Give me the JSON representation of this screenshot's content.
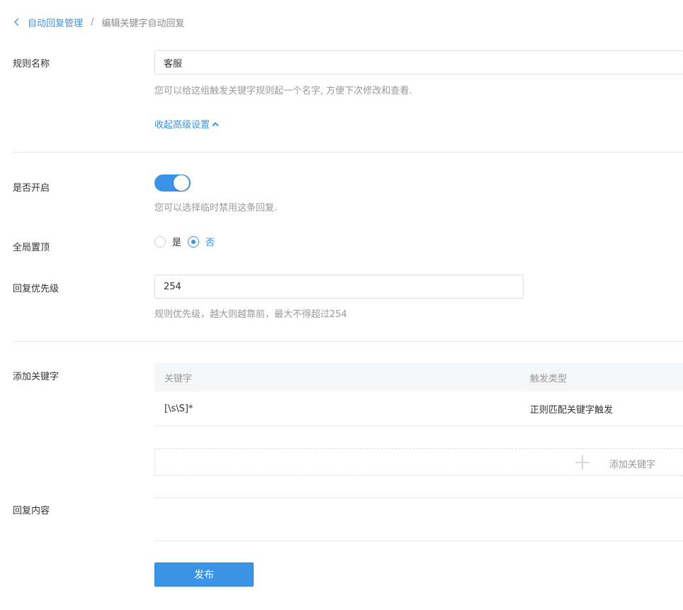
{
  "breadcrumb": {
    "parent": "自动回复管理",
    "separator": "/",
    "current": "编辑关键字自动回复"
  },
  "form": {
    "rule_name": {
      "label": "规则名称",
      "value": "客服",
      "help": "您可以给这组触发关键字规则起一个名字, 方便下次修改和查看."
    },
    "advanced_toggle_label": "收起高级设置",
    "enabled": {
      "label": "是否开启",
      "on": true,
      "help": "您可以选择临时禁用这条回复."
    },
    "pin_top": {
      "label": "全局置顶",
      "options": [
        "是",
        "否"
      ],
      "selected": "否"
    },
    "priority": {
      "label": "回复优先级",
      "value": "254",
      "help": "规则优先级，越大则越靠前，最大不得超过254"
    },
    "keywords": {
      "label": "添加关键字",
      "columns": [
        "关键字",
        "触发类型"
      ],
      "rows": [
        {
          "keyword": "[\\s\\S]*",
          "trigger_type": "正则匹配关键字触发"
        }
      ],
      "add_label": "添加关键字"
    },
    "reply_content": {
      "label": "回复内容"
    },
    "submit_label": "发布"
  },
  "colors": {
    "accent": "#3b93e6",
    "muted_text": "#999999",
    "divider": "#e8e8e8"
  }
}
